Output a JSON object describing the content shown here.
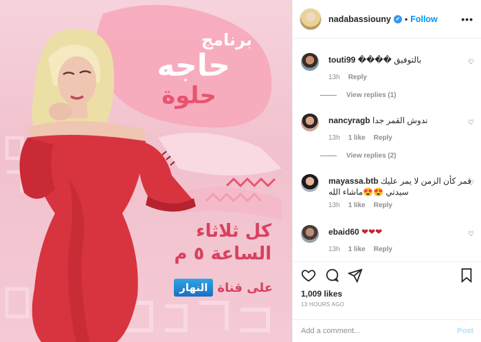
{
  "media": {
    "show_title_line1": "برنامج",
    "show_title_line2": "حاجه",
    "show_title_line3": "حلوة",
    "schedule_line1": "كل ثلاثاء",
    "schedule_line2": "الساعة ٥ م",
    "channel_prefix": "على قناة",
    "channel_name": "النهار"
  },
  "header": {
    "username": "nadabassiouny",
    "verified_glyph": "✔",
    "separator": "•",
    "follow_label": "Follow"
  },
  "comments": [
    {
      "username": "touti99",
      "text": "بالتوفيق ����",
      "time": "13h",
      "likes": "",
      "reply": "Reply",
      "view_replies": "View replies (1)"
    },
    {
      "username": "nancyragb",
      "text": "ندوش القمر جدا",
      "time": "13h",
      "likes": "1 like",
      "reply": "Reply",
      "view_replies": "View replies (2)"
    },
    {
      "username": "mayassa.btb",
      "text": "قمر كأن الزمن لا يمر عليك سيدتي 😍😍ماشاء الله",
      "time": "13h",
      "likes": "1 like",
      "reply": "Reply",
      "view_replies": ""
    },
    {
      "username": "ebaid60",
      "text": "❤❤❤",
      "time": "13h",
      "likes": "1 like",
      "reply": "Reply",
      "view_replies": ""
    }
  ],
  "post": {
    "likes_count": "1,009 likes",
    "time_ago": "13 HOURS AGO"
  },
  "add_comment": {
    "placeholder": "Add a comment...",
    "post_label": "Post"
  },
  "icons": {
    "heart": "heart-icon",
    "comment": "comment-icon",
    "share": "share-icon",
    "save": "bookmark-icon",
    "more": "more-options-icon"
  },
  "colors": {
    "accent_blue": "#0095f6",
    "post_disabled": "#b2dffc",
    "image_pink": "#f1c1cd",
    "dress_red": "#d8343f"
  }
}
